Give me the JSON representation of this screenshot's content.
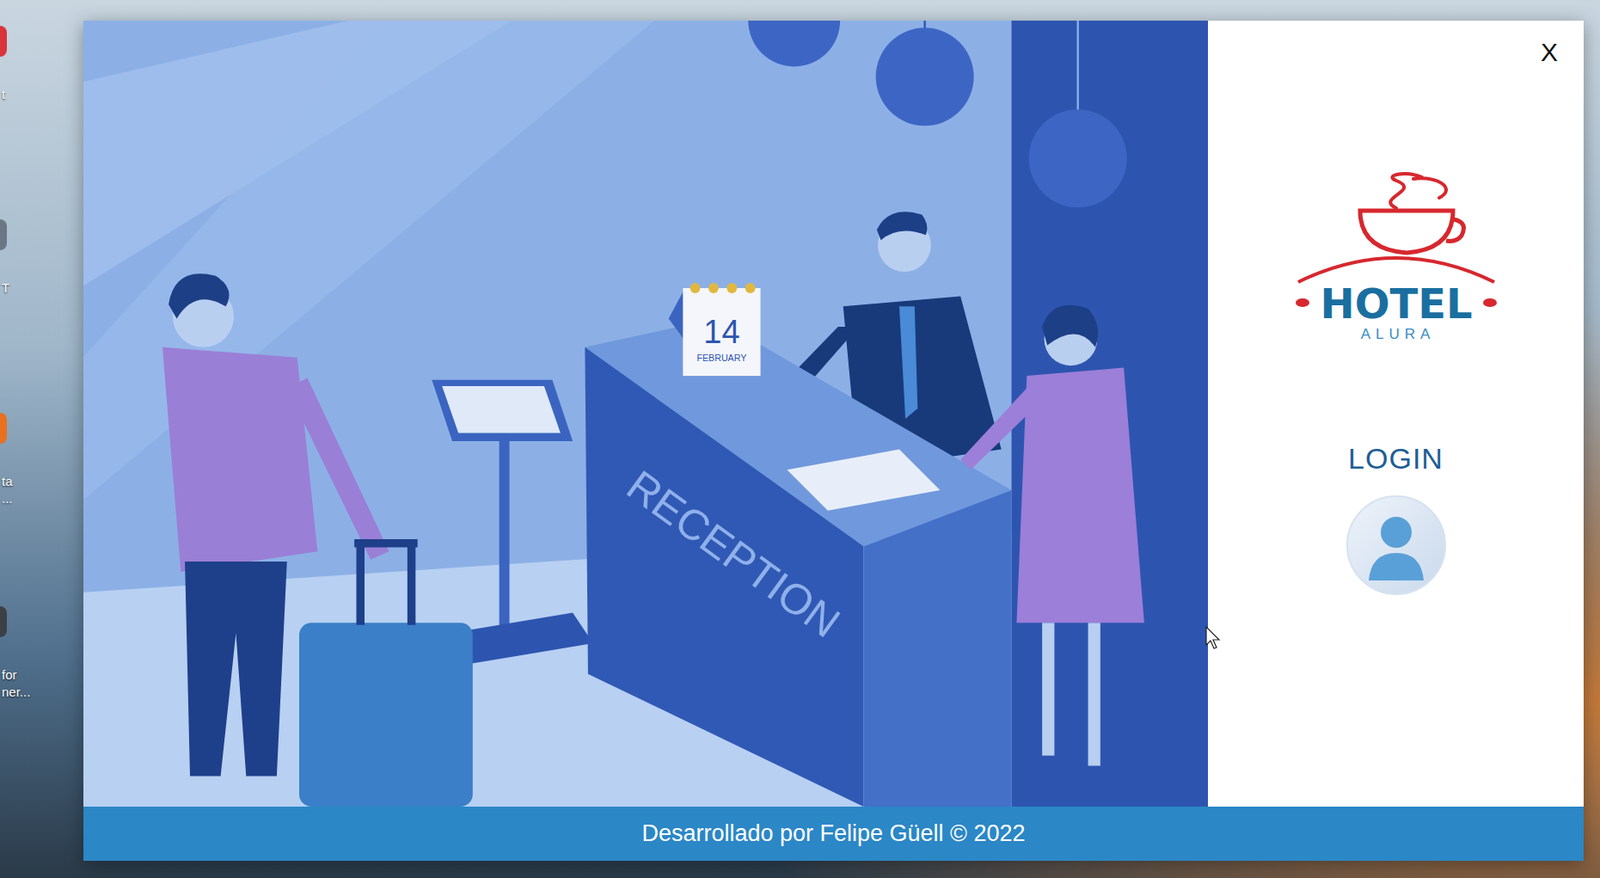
{
  "desktop": {
    "icons": [
      {
        "lines": [
          "t"
        ],
        "color": "#d9343a"
      },
      {
        "lines": [
          "T"
        ],
        "color": "#6b7785"
      },
      {
        "lines": [
          "ta",
          "..."
        ],
        "color": "#e8701e"
      },
      {
        "lines": [
          "for",
          "ner..."
        ],
        "color": "#3b3f46"
      }
    ]
  },
  "window": {
    "close": "X",
    "logo": {
      "title": "HOTEL",
      "subtitle": "ALURA"
    },
    "login": {
      "label": "LOGIN"
    },
    "footer": "Desarrollado por Felipe Güell © 2022"
  },
  "illustration": {
    "desk_sign": "RECEPTION",
    "calendar": {
      "day": "14",
      "month": "FEBRUARY"
    }
  }
}
